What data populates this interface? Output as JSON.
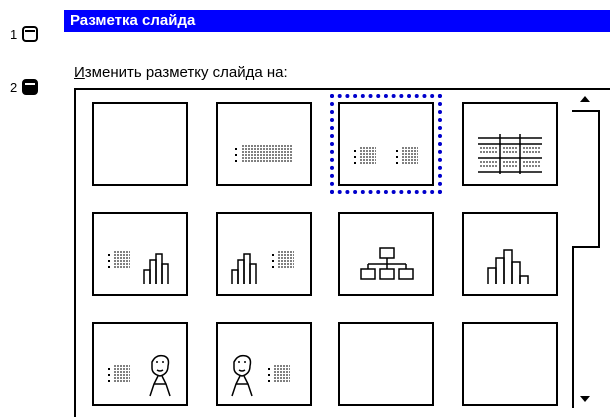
{
  "callouts": {
    "first_number": "1",
    "second_number": "2",
    "first_icon": "window-restore-icon",
    "second_icon": "window-filled-icon"
  },
  "panel": {
    "title": "Разметка слайда",
    "prompt_underlined": "И",
    "prompt_rest": "зменить разметку слайда на:"
  },
  "colors": {
    "title_bar": "#0000ff",
    "selection": "#0000cc"
  },
  "layouts": [
    {
      "icon": "blank-layout-icon",
      "selected": false
    },
    {
      "icon": "text-layout-icon",
      "selected": false
    },
    {
      "icon": "two-column-text-layout-icon",
      "selected": true
    },
    {
      "icon": "table-layout-icon",
      "selected": false
    },
    {
      "icon": "text-and-chart-layout-icon",
      "selected": false
    },
    {
      "icon": "chart-and-text-layout-icon",
      "selected": false
    },
    {
      "icon": "org-chart-layout-icon",
      "selected": false
    },
    {
      "icon": "chart-layout-icon",
      "selected": false
    },
    {
      "icon": "text-and-clipart-layout-icon",
      "selected": false
    },
    {
      "icon": "clipart-and-text-layout-icon",
      "selected": false
    },
    {
      "icon": "title-only-layout-icon",
      "selected": false
    },
    {
      "icon": "blank-layout-icon",
      "selected": false
    }
  ],
  "scrollbar": {
    "up_icon": "scroll-up-arrow-icon",
    "down_icon": "scroll-down-arrow-icon"
  }
}
